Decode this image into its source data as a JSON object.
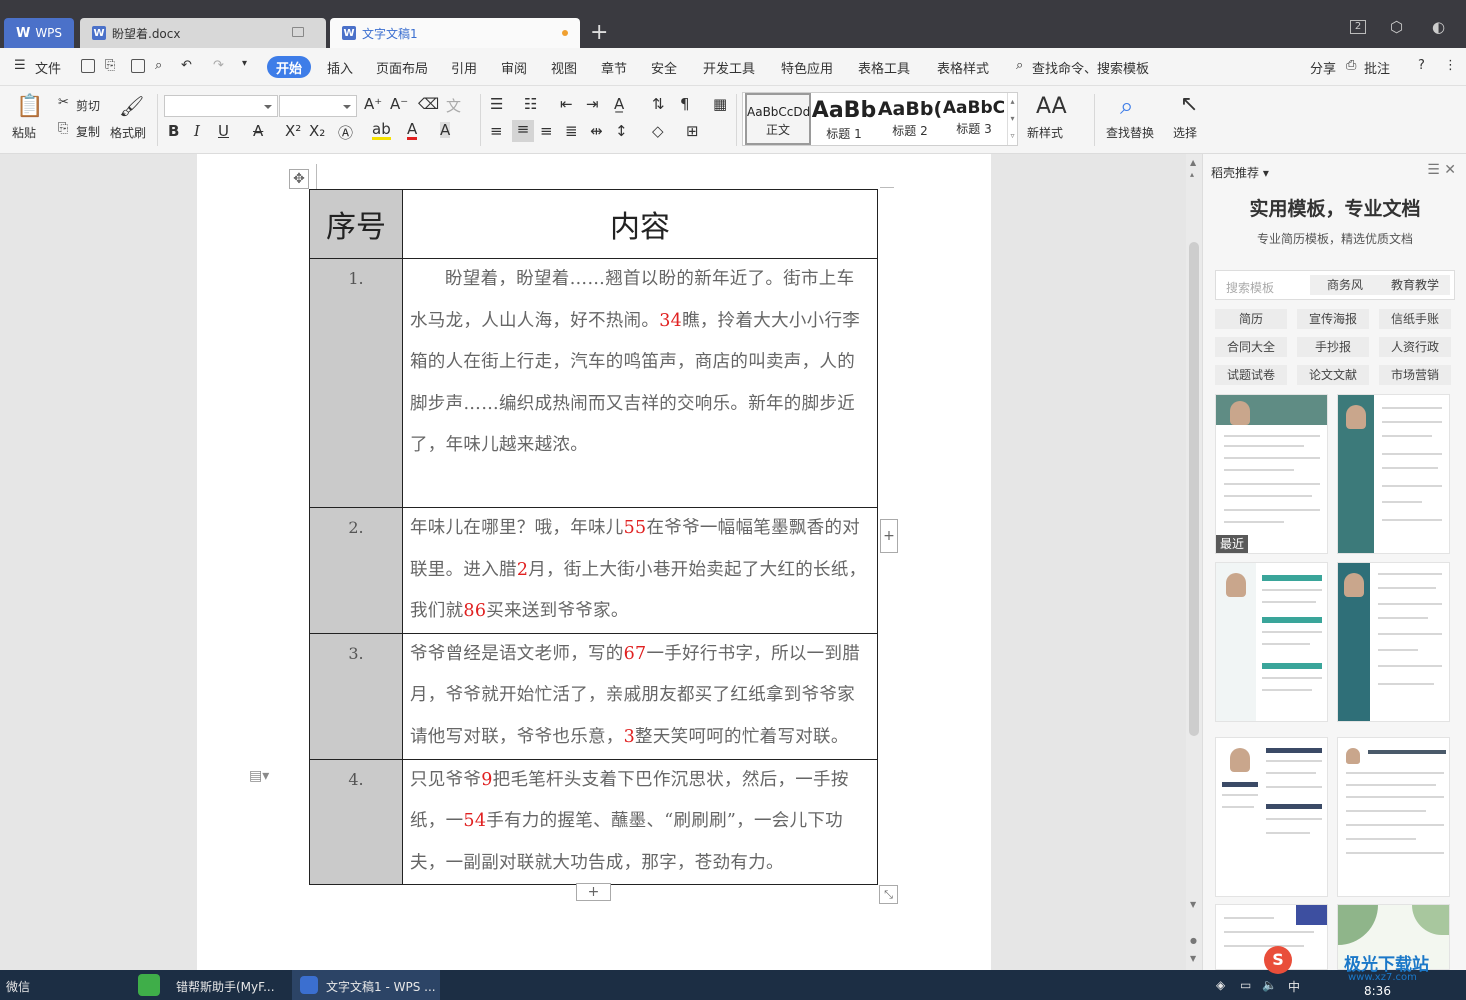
{
  "titlebar": {
    "wps_label": "WPS",
    "tab1": "盼望着.docx",
    "tab2": "文字文稿1",
    "new_tab": "+",
    "user_count": "2"
  },
  "menu": {
    "file": "文件",
    "items": [
      "开始",
      "插入",
      "页面布局",
      "引用",
      "审阅",
      "视图",
      "章节",
      "安全",
      "开发工具",
      "特色应用",
      "表格工具",
      "表格样式"
    ],
    "search": "查找命令、搜索模板",
    "share": "分享",
    "comment": "批注",
    "help": "?"
  },
  "ribbon": {
    "paste": "粘贴",
    "cut": "剪切",
    "copy": "复制",
    "format_painter": "格式刷",
    "bold": "B",
    "italic": "I",
    "underline": "U",
    "styles": [
      {
        "sample": "AaBbCcDd",
        "name": "正文"
      },
      {
        "sample": "AaBb",
        "name": "标题 1"
      },
      {
        "sample": "AaBb(",
        "name": "标题 2"
      },
      {
        "sample": "AaBbC",
        "name": "标题 3"
      }
    ],
    "new_style": "新样式",
    "find_replace": "查找替换",
    "select": "选择"
  },
  "table": {
    "headers": [
      "序号",
      "内容"
    ],
    "rows": [
      {
        "num": "1.",
        "parts": [
          "盼望着，盼望着……翘首以盼的新年近了。街市上车水马龙，人山人海，好不热闹。",
          "34",
          "瞧，拎着大大小小行李箱的人在街上行走，汽车的鸣笛声，商店的叫卖声，人的脚步声……编织成热闹而又吉祥的交响乐。新年的脚步近了，年味儿越来越浓。"
        ]
      },
      {
        "num": "2.",
        "parts": [
          "年味儿在哪里？哦，年味儿",
          "55",
          "在爷爷一幅幅笔墨飘香的对联里。进入腊",
          "2",
          "月，街上大街小巷开始卖起了大红的长纸，我们就",
          "86",
          "买来送到爷爷家。"
        ]
      },
      {
        "num": "3.",
        "parts": [
          "爷爷曾经是语文老师，写的",
          "67",
          "一手好行书字，所以一到腊月，爷爷就开始忙活了，亲戚朋友都买了红纸拿到爷爷家请他写对联，爷爷也乐意，",
          "3",
          "整天笑呵呵的忙着写对联。"
        ]
      },
      {
        "num": "4.",
        "parts": [
          "只见爷爷",
          "9",
          "把毛笔杆头支着下巴作沉思状，然后，一手按纸，一",
          "54",
          "手有力的握笔、蘸墨、“刷刷刷”，一会儿下功夫，一副副对联就大功告成，那字，苍劲有力。"
        ]
      }
    ]
  },
  "sidepanel": {
    "title": "稻壳推荐",
    "headline": "实用模板，专业文档",
    "subtitle": "专业简历模板，精选优质文档",
    "search_placeholder": "搜索模板",
    "chips": [
      "商务风",
      "教育教学"
    ],
    "categories": [
      "简历",
      "宣传海报",
      "信纸手账",
      "合同大全",
      "手抄报",
      "人资行政",
      "试题试卷",
      "论文文献",
      "市场营销"
    ],
    "recent_badge": "最近"
  },
  "taskbar": {
    "item1": "微信",
    "item2": "错帮斯助手(MyF...",
    "item3": "文字文稿1 - WPS ...",
    "time": "8:36",
    "ime": "中"
  },
  "watermark": {
    "text": "极光下载站",
    "url": "www.xz7.com"
  },
  "colors": {
    "accent": "#3e7de8",
    "number_red": "#e02020",
    "header_gray": "#cacaca",
    "taskbar": "#1c2e44"
  }
}
